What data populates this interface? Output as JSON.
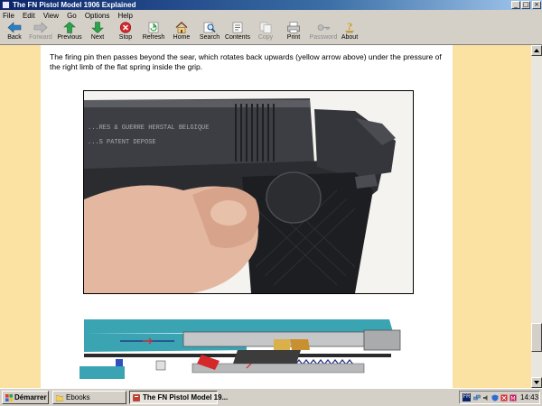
{
  "window": {
    "title": "The FN Pistol Model 1906 Explained",
    "controls": {
      "minimize": "_",
      "maximize": "□",
      "close": "×"
    }
  },
  "menu": [
    "File",
    "Edit",
    "View",
    "Go",
    "Options",
    "Help"
  ],
  "toolbar": [
    {
      "label": "Back",
      "icon": "back-arrow-icon",
      "enabled": true
    },
    {
      "label": "Forward",
      "icon": "forward-arrow-icon",
      "enabled": false
    },
    {
      "label": "Previous",
      "icon": "up-arrow-icon",
      "enabled": true
    },
    {
      "label": "Next",
      "icon": "down-arrow-icon",
      "enabled": true
    },
    {
      "label": "Stop",
      "icon": "stop-icon",
      "enabled": true
    },
    {
      "label": "Refresh",
      "icon": "refresh-icon",
      "enabled": true
    },
    {
      "label": "Home",
      "icon": "home-icon",
      "enabled": true
    },
    {
      "label": "Search",
      "icon": "search-icon",
      "enabled": true
    },
    {
      "label": "Contents",
      "icon": "contents-icon",
      "enabled": true
    },
    {
      "label": "Copy",
      "icon": "copy-icon",
      "enabled": false
    },
    {
      "label": "Print",
      "icon": "print-icon",
      "enabled": true
    },
    {
      "label": "Password",
      "icon": "password-key-icon",
      "enabled": false
    },
    {
      "label": "About",
      "icon": "about-icon",
      "enabled": true
    }
  ],
  "content": {
    "paragraph": "The firing pin then passes beyond the sear, which rotates back upwards (yellow arrow above) under the pressure of the right limb of the flat spring inside the grip.",
    "photo_engraving": "...RES & GUERRE HERSTAL BELGIQUE",
    "photo_patent": "...S PATENT    DEPOSE"
  },
  "taskbar": {
    "start_label": "Démarrer",
    "tasks": [
      {
        "label": "Ebooks",
        "active": false
      },
      {
        "label": "The FN Pistol Model 19...",
        "active": true
      }
    ],
    "tray_lang": "FR",
    "clock": "14:43"
  },
  "colors": {
    "title_bar": "#0a246a",
    "page_background": "#ffffff",
    "side_background": "#fbe2a3",
    "chrome": "#d4d0c8"
  }
}
